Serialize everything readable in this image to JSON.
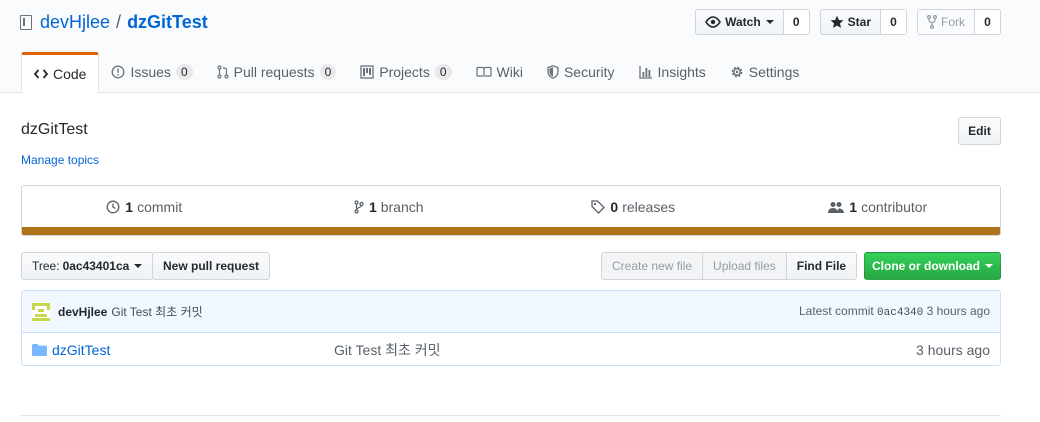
{
  "repo": {
    "owner": "devHjlee",
    "separator": "/",
    "name": "dzGitTest"
  },
  "actions": {
    "watch": {
      "label": "Watch",
      "count": "0"
    },
    "star": {
      "label": "Star",
      "count": "0"
    },
    "fork": {
      "label": "Fork",
      "count": "0"
    }
  },
  "tabs": [
    {
      "label": "Code",
      "icon": "code-icon"
    },
    {
      "label": "Issues",
      "count": "0",
      "icon": "issue-icon"
    },
    {
      "label": "Pull requests",
      "count": "0",
      "icon": "pull-request-icon"
    },
    {
      "label": "Projects",
      "count": "0",
      "icon": "project-icon"
    },
    {
      "label": "Wiki",
      "icon": "book-icon"
    },
    {
      "label": "Security",
      "icon": "shield-icon"
    },
    {
      "label": "Insights",
      "icon": "graph-icon"
    },
    {
      "label": "Settings",
      "icon": "gear-icon"
    }
  ],
  "description": "dzGitTest",
  "edit_label": "Edit",
  "manage_topics": "Manage topics",
  "summary": {
    "commits": {
      "num": "1",
      "label": "commit"
    },
    "branches": {
      "num": "1",
      "label": "branch"
    },
    "releases": {
      "num": "0",
      "label": "releases"
    },
    "contributors": {
      "num": "1",
      "label": "contributor"
    },
    "language_color": "#b07219"
  },
  "toolbar": {
    "tree_prefix": "Tree:",
    "tree_value": "0ac43401ca",
    "new_pr": "New pull request",
    "create_file": "Create new file",
    "upload_files": "Upload files",
    "find_file": "Find File",
    "clone": "Clone or download",
    "clone_color": "#28a745"
  },
  "commit": {
    "author": "devHjlee",
    "message": "Git Test 최초 커밋",
    "latest_label": "Latest commit",
    "sha": "0ac4340",
    "age": "3 hours ago"
  },
  "files": [
    {
      "name": "dzGitTest",
      "message": "Git Test 최초 커밋",
      "age": "3 hours ago",
      "icon": "folder-icon"
    }
  ]
}
